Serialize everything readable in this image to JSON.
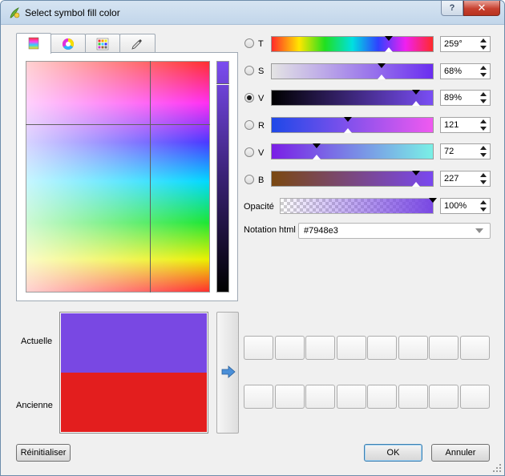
{
  "window": {
    "title": "Select symbol fill color",
    "help_label": "?",
    "close_label": "✕"
  },
  "tabs": [
    {
      "name": "color-ramp-icon"
    },
    {
      "name": "color-wheel-icon"
    },
    {
      "name": "swatch-grid-icon"
    },
    {
      "name": "eyedropper-icon"
    }
  ],
  "channels": [
    {
      "label": "T",
      "value": "259°",
      "selected": false,
      "marker": 0.72
    },
    {
      "label": "S",
      "value": "68%",
      "selected": false,
      "marker": 0.68
    },
    {
      "label": "V",
      "value": "89%",
      "selected": true,
      "marker": 0.89
    },
    {
      "label": "R",
      "value": "121",
      "selected": false,
      "marker": 0.47
    },
    {
      "label": "V",
      "value": "72",
      "selected": false,
      "marker": 0.28
    },
    {
      "label": "B",
      "value": "227",
      "selected": false,
      "marker": 0.89
    }
  ],
  "opacity": {
    "label": "Opacité",
    "value": "100%",
    "marker": 1.0
  },
  "html_notation": {
    "label": "Notation html",
    "value": "#7948e3"
  },
  "preview": {
    "actual_label": "Actuelle",
    "old_label": "Ancienne",
    "actual_color": "#7948e3",
    "old_color": "#e31e1e"
  },
  "buttons": {
    "reset": "Réinitialiser",
    "ok": "OK",
    "cancel": "Annuler"
  },
  "colors": {
    "accent": "#7948e3"
  }
}
